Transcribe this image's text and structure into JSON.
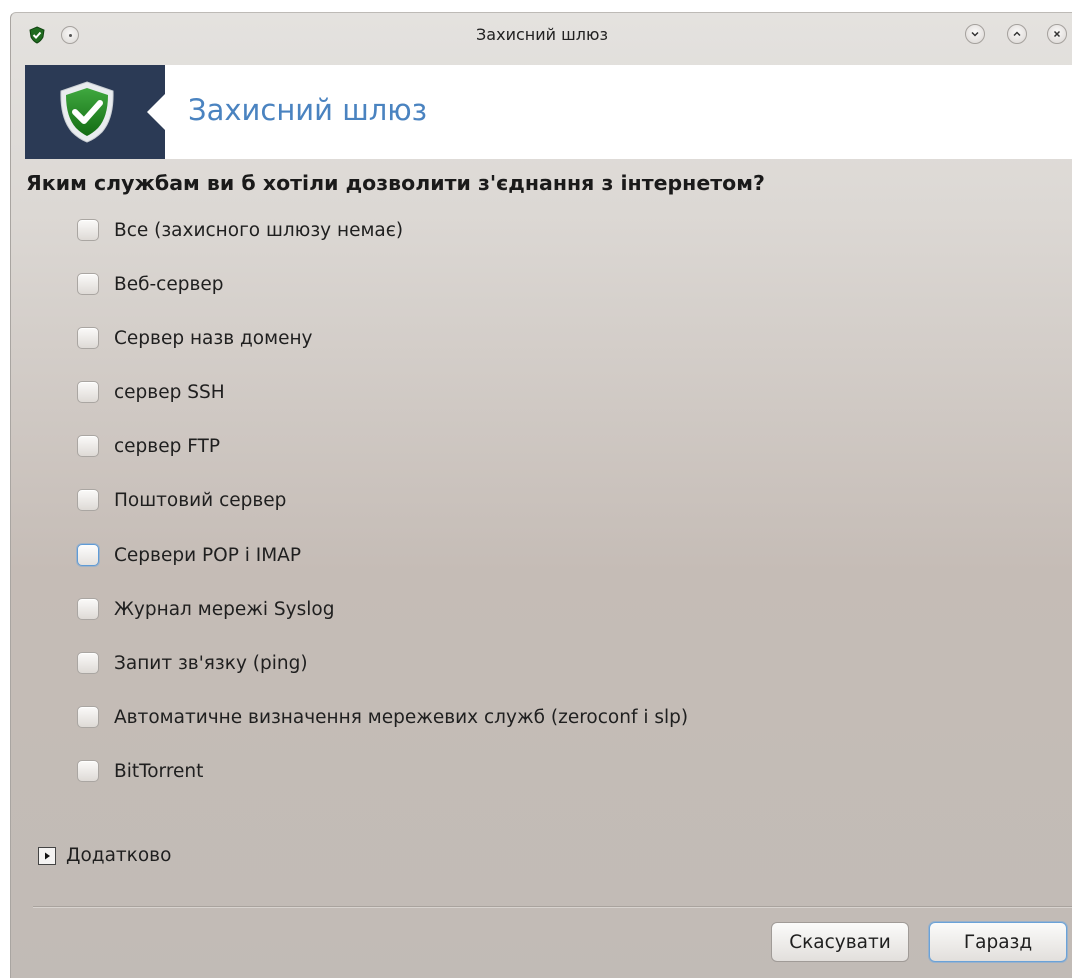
{
  "window": {
    "title": "Захисний шлюз"
  },
  "titlebar_icons": {
    "app": "shield-check-icon",
    "menu": "window-menu-icon",
    "minimize": "chevron-down-icon",
    "maximize": "chevron-up-icon",
    "close": "close-icon"
  },
  "banner": {
    "title": "Захисний шлюз",
    "icon": "shield-check-icon",
    "accent_color": "#4a83c0",
    "panel_color": "#2b3a55"
  },
  "question": "Яким службам ви б хотіли дозволити з'єднання з інтернетом?",
  "options": [
    {
      "label": "Все (захисного шлюзу немає)",
      "checked": false
    },
    {
      "label": "Веб-сервер",
      "checked": false
    },
    {
      "label": "Сервер назв домену",
      "checked": false
    },
    {
      "label": "сервер SSH",
      "checked": false
    },
    {
      "label": "сервер FTP",
      "checked": false
    },
    {
      "label": "Поштовий сервер",
      "checked": false
    },
    {
      "label": "Сервери POP і IMAP",
      "checked": false,
      "focused": true
    },
    {
      "label": "Журнал мережі Syslog",
      "checked": false
    },
    {
      "label": "Запит зв'язку (ping)",
      "checked": false
    },
    {
      "label": "Автоматичне визначення мережевих служб (zeroconf і slp)",
      "checked": false
    },
    {
      "label": "BitTorrent",
      "checked": false
    }
  ],
  "advanced": {
    "label": "Додатково",
    "expanded": false
  },
  "buttons": {
    "cancel": "Скасувати",
    "ok": "Гаразд"
  }
}
